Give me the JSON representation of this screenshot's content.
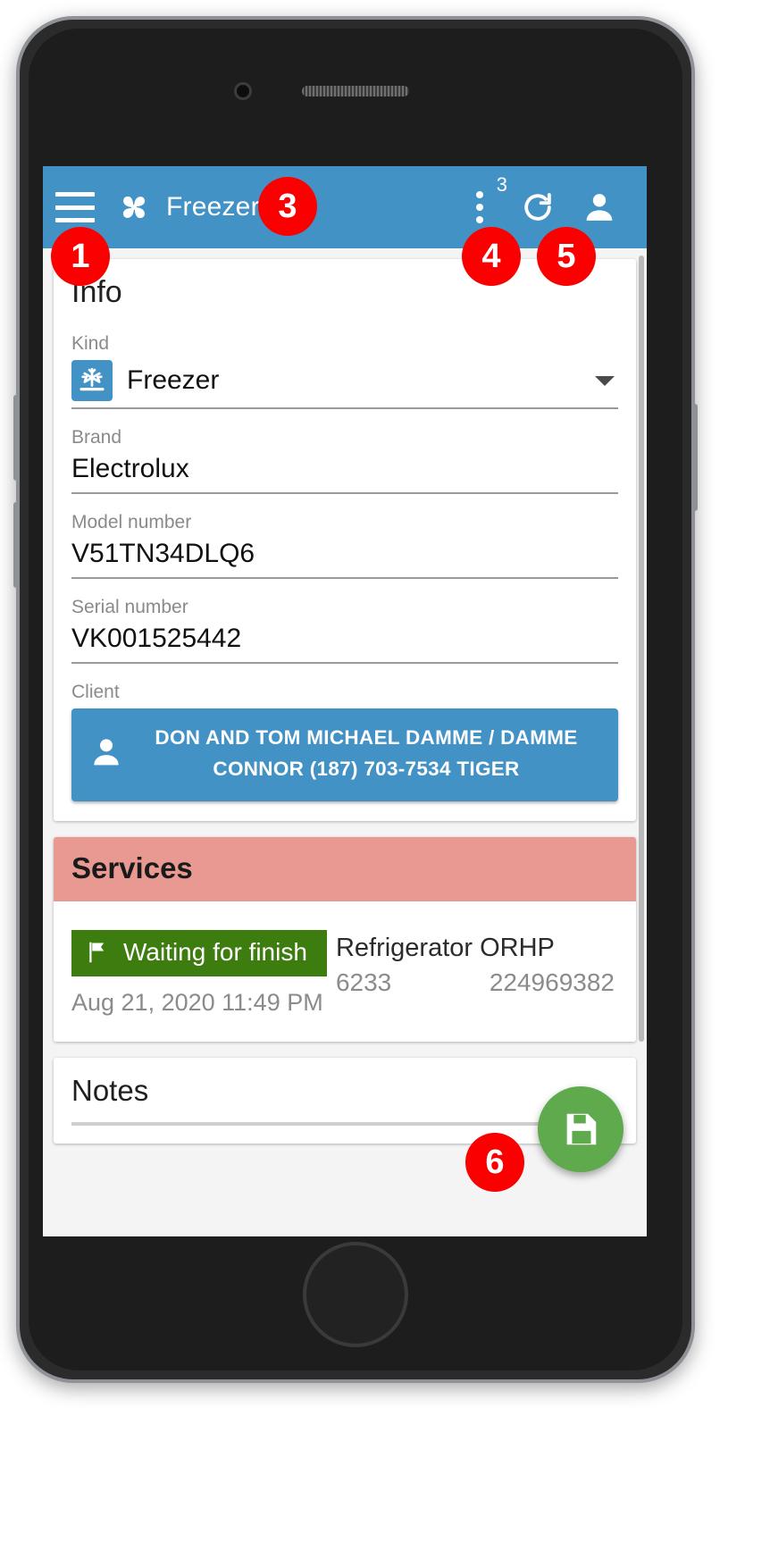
{
  "appbar": {
    "menu_icon": "hamburger-menu-icon",
    "logo_icon": "pinwheel-logo-icon",
    "title": "Freezer",
    "overflow_icon": "overflow-menu-icon",
    "overflow_badge": "3",
    "refresh_icon": "refresh-icon",
    "account_icon": "account-person-icon"
  },
  "info": {
    "title": "Info",
    "kind": {
      "label": "Kind",
      "value": "Freezer",
      "icon": "freezer-snowflake-icon",
      "caret": "chevron-down-icon"
    },
    "brand": {
      "label": "Brand",
      "value": "Electrolux"
    },
    "model": {
      "label": "Model number",
      "value": "V51TN34DLQ6"
    },
    "serial": {
      "label": "Serial number",
      "value": "VK001525442"
    },
    "client": {
      "label": "Client",
      "icon": "person-icon",
      "line1": "DON AND TOM MICHAEL DAMME / DAMME",
      "line2": "CONNOR (187) 703-7534 TIGER"
    }
  },
  "services": {
    "title": "Services",
    "items": [
      {
        "status": "Waiting for finish",
        "status_icon": "flag-icon",
        "date": "Aug 21, 2020 11:49 PM",
        "name": "Refrigerator ORHP",
        "number_left": "6233",
        "number_right": "224969382"
      }
    ]
  },
  "notes": {
    "title": "Notes"
  },
  "fab": {
    "icon": "save-floppy-icon"
  },
  "markers": {
    "m1": "1",
    "m3": "3",
    "m4": "4",
    "m5": "5",
    "m6": "6"
  },
  "colors": {
    "appbar": "#4292c6",
    "services_header": "#e89a92",
    "status_chip": "#3d7c0f",
    "fab": "#5faa4c",
    "marker": "#fb0000"
  }
}
